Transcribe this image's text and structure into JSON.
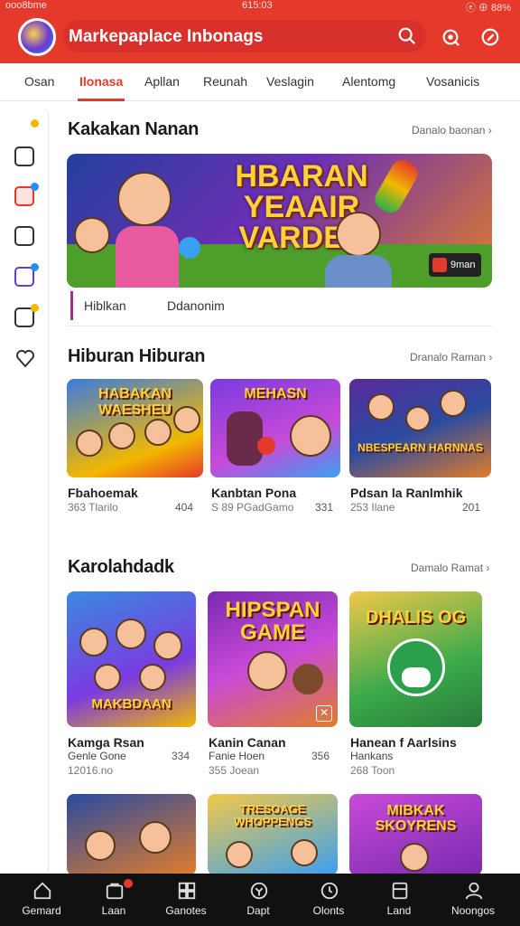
{
  "status_bar": {
    "left": "ooo8bme",
    "time": "615:03",
    "right": "ⓔ ⊕ 88%"
  },
  "header": {
    "title": "Markepaplace Inbonags",
    "brand_color": "#e53a2b"
  },
  "tabs": [
    {
      "label": "Osan"
    },
    {
      "label": "Ilonasa"
    },
    {
      "label": "Apllan"
    },
    {
      "label": "Reunah"
    },
    {
      "label": "Veslagin"
    },
    {
      "label": "Alentomg"
    },
    {
      "label": "Vosanicis"
    }
  ],
  "featured": {
    "title": "Kakakan Nanan",
    "see_all": "Danalo baonan ›",
    "banner_text": "HBARAN YEAAIR VARDES",
    "badge_text": "9man",
    "subtabs": [
      "Hiblkan",
      "Ddanonim"
    ]
  },
  "section2": {
    "title": "Hiburan Hiburan",
    "see_all": "Dranalo Raman ›",
    "cards": [
      {
        "art": "HABAKAN WAESHEU",
        "title": "Fbahoemak",
        "sub": "363 Tlarilo",
        "num": "404"
      },
      {
        "art": "MEHASN",
        "title": "Kanbtan Pona",
        "sub": "S 89 PGadGamo",
        "num": "331"
      },
      {
        "art": "NBESPEARN HARNNAS",
        "title": "Pdsan la Ranlmhik",
        "sub": "253 Ilane",
        "num": "201"
      }
    ]
  },
  "section3": {
    "title": "Karolahdadk",
    "see_all": "Damalo Ramat ›",
    "cards": [
      {
        "art": "MAKBDAAN",
        "title": "Kamga Rsan",
        "sub": "Genle Gone",
        "sub2": "12016.no",
        "num": "334"
      },
      {
        "art": "HIPSPAN GAME",
        "title": "Kanin Canan",
        "sub": "Fanie Hoen",
        "sub2": "355 Joean",
        "num": "356"
      },
      {
        "art": "DHALIS OG",
        "title": "Hanean f Aarlsins",
        "sub": "Hankans",
        "sub2": "268 Toon",
        "num": ""
      }
    ],
    "more_cards": [
      {
        "art": ""
      },
      {
        "art": "TRESOAGE WHOPPENGS"
      },
      {
        "art": "MIBKAK SKOYRENS"
      }
    ]
  },
  "bottom_nav": [
    {
      "label": "Gemard",
      "icon": "home-icon"
    },
    {
      "label": "Laan",
      "icon": "bag-icon"
    },
    {
      "label": "Ganotes",
      "icon": "grid-icon"
    },
    {
      "label": "Dapt",
      "icon": "location-icon"
    },
    {
      "label": "Olonts",
      "icon": "clock-icon"
    },
    {
      "label": "Land",
      "icon": "box-icon"
    },
    {
      "label": "Noongos",
      "icon": "profile-icon"
    }
  ]
}
